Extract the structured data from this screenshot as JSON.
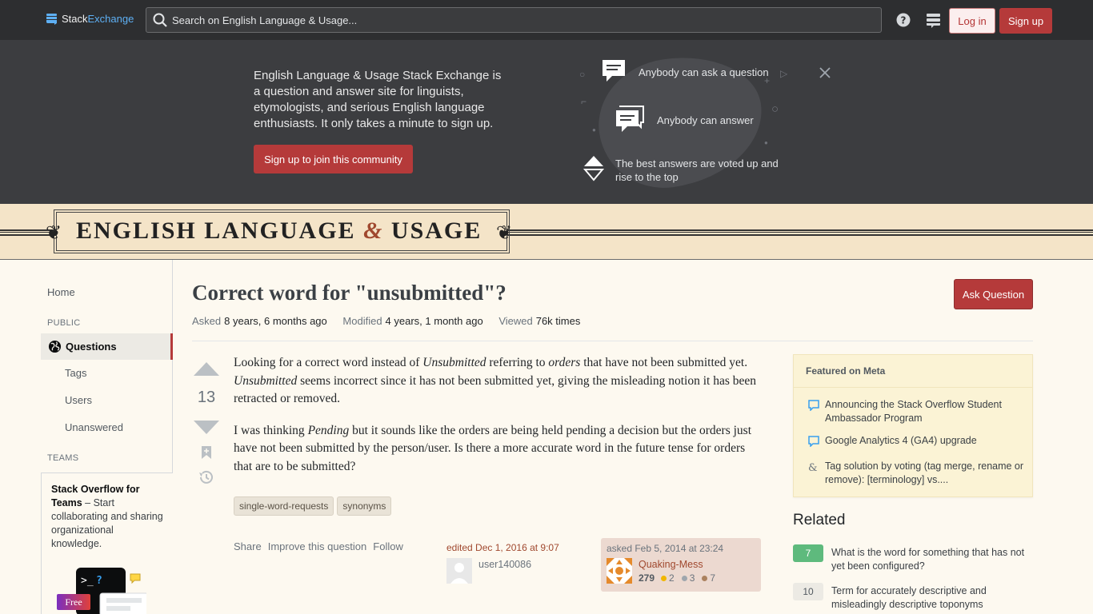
{
  "topbar": {
    "logo_stack": "Stack",
    "logo_exchange": "Exchange",
    "search_placeholder": "Search on English Language & Usage...",
    "help_icon": "question-circle-icon",
    "inbox_icon": "site-switcher-icon",
    "login_label": "Log in",
    "signup_label": "Sign up"
  },
  "hero": {
    "description": "English Language & Usage Stack Exchange is a question and answer site for linguists, etymologists, and serious English language enthusiasts. It only takes a minute to sign up.",
    "cta_label": "Sign up to join this community",
    "features": [
      "Anybody can ask a question",
      "Anybody can answer",
      "The best answers are voted up and rise to the top"
    ]
  },
  "site": {
    "title_part1": "ENGLISH LANGUAGE",
    "title_amp": "&",
    "title_part2": "USAGE"
  },
  "nav": {
    "home": "Home",
    "public_label": "PUBLIC",
    "questions": "Questions",
    "tags": "Tags",
    "users": "Users",
    "unanswered": "Unanswered",
    "teams_label": "TEAMS",
    "teams_title": "Stack Overflow for Teams",
    "teams_text": " – Start collaborating and sharing organizational knowledge.",
    "free_badge": "Free"
  },
  "question": {
    "title": "Correct word for \"unsubmitted\"?",
    "ask_button": "Ask Question",
    "asked_label": "Asked",
    "asked_value": "8 years, 6 months ago",
    "modified_label": "Modified",
    "modified_value": "4 years, 1 month ago",
    "viewed_label": "Viewed",
    "viewed_value": "76k times",
    "votes": "13",
    "p1_a": "Looking for a correct word instead of ",
    "p1_em1": "Unsubmitted",
    "p1_b": " referring to ",
    "p1_em2": "orders",
    "p1_c": " that have not been submitted yet. ",
    "p1_em3": "Unsubmitted",
    "p1_d": " seems incorrect since it has not been submitted yet, giving the misleading notion it has been retracted or removed.",
    "p2_a": "I was thinking ",
    "p2_em1": "Pending",
    "p2_b": " but it sounds like the orders are being held pending a decision but the orders just have not been submitted by the person/user. Is there a more accurate word in the future tense for orders that are to be submitted?",
    "tags": [
      "single-word-requests",
      "synonyms"
    ],
    "actions": {
      "share": "Share",
      "improve": "Improve this question",
      "follow": "Follow"
    },
    "edited": "edited Dec 1, 2016 at 9:07",
    "editor": "user140086",
    "asked_time": "asked Feb 5, 2014 at 23:24",
    "asker": "Quaking-Mess",
    "asker_rep": "279",
    "gold": "2",
    "silver": "3",
    "bronze": "7"
  },
  "featured": {
    "heading": "Featured on Meta",
    "items": [
      "Announcing the Stack Overflow Student Ambassador Program",
      "Google Analytics 4 (GA4) upgrade",
      "Tag solution by voting (tag merge, rename or remove): [terminology] vs...."
    ]
  },
  "related": {
    "heading": "Related",
    "items": [
      {
        "score": "7",
        "text": "What is the word for something that has not yet been configured?"
      },
      {
        "score": "10",
        "text": "Term for accurately descriptive and misleadingly descriptive toponyms"
      }
    ]
  },
  "colors": {
    "accent": "#b53a3a",
    "banner_bg": "#f4e4c8",
    "hero_bg": "#3c3d40",
    "answered_green": "#5eba7d"
  }
}
